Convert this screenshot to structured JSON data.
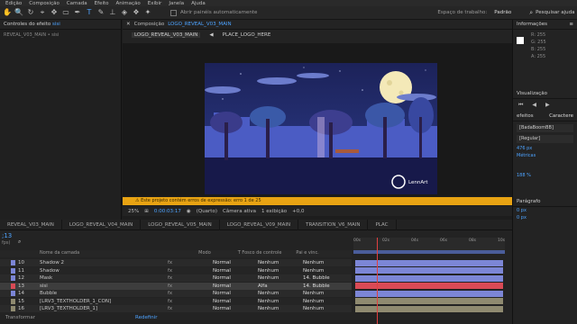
{
  "menu": [
    "Edição",
    "Composição",
    "Camada",
    "Efeito",
    "Animação",
    "Exibir",
    "Janela",
    "Ajuda"
  ],
  "toolbar": {
    "auto_open_label": "Abrir painéis automaticamente",
    "workspace_label": "Espaço de trabalho:",
    "workspace_value": "Padrão",
    "search_help": "Pesquisar ajuda"
  },
  "left_panel": {
    "tab": "Controles do efeito",
    "tab_suffix": "sisi",
    "subtitle": "REVEAL_V03_MAIN • sisi"
  },
  "comp": {
    "tab": "Composição",
    "tab_name": "LOGO_REVEAL_V03_MAIN",
    "crumb1": "LOGO_REVEAL_V03_MAIN",
    "crumb2": "PLACE_LOGO_HERE",
    "warning": "Este projeto contém erros de expressão: erro 1 de 25",
    "zoom": "25%",
    "timecode": "0:00:03:17",
    "quality": "(Quarto)",
    "camera": "Câmera ativa",
    "view": "1 exibição",
    "exposure": "+0,0",
    "logo_text": "LennArt"
  },
  "timeline_tabs": [
    "REVEAL_V03_MAIN",
    "LOGO_REVEAL_V04_MAIN",
    "LOGO_REVEAL_V05_MAIN",
    "LOGO_REVEAL_V09_MAIN",
    "TRANSITION_V6_MAIN",
    "PLAC"
  ],
  "timeline": {
    "time": ";13",
    "fps": "fps)",
    "col_name": "Nome da camada",
    "col_mode": "Modo",
    "col_track": "T   Fosco de controle",
    "col_parent": "Pai e vinc.",
    "ruler": [
      "00s",
      "02s",
      "04s",
      "06s",
      "08s",
      "10s"
    ],
    "footer_left": "Transformar",
    "footer_right": "Redefinir",
    "layers": [
      {
        "num": "10",
        "name": "Shadow 2",
        "mode": "Normal",
        "track": "Nenhum",
        "parent": "Nenhum",
        "color": "#7c86d6"
      },
      {
        "num": "11",
        "name": "Shadow",
        "mode": "Normal",
        "track": "Nenhum",
        "parent": "Nenhum",
        "color": "#7c86d6"
      },
      {
        "num": "12",
        "name": "Mask",
        "mode": "Normal",
        "track": "Nenhum",
        "parent": "14. Bubble",
        "color": "#7c86d6"
      },
      {
        "num": "13",
        "name": "sisi",
        "mode": "Normal",
        "track": "Alfa",
        "parent": "14. Bubble",
        "color": "#d94a55"
      },
      {
        "num": "14",
        "name": "Bubble",
        "mode": "Normal",
        "track": "Nenhum",
        "parent": "Nenhum",
        "color": "#7c86d6"
      },
      {
        "num": "15",
        "name": "[LRV3_TEXTHOLDER_1_CON]",
        "mode": "Normal",
        "track": "Nenhum",
        "parent": "Nenhum",
        "color": "#8f8a70"
      },
      {
        "num": "16",
        "name": "[LRV3_TEXTHOLDER_1]",
        "mode": "Normal",
        "track": "Nenhum",
        "parent": "Nenhum",
        "color": "#8f8a70"
      }
    ]
  },
  "right_panel": {
    "info_title": "Informações",
    "r": "R: 255",
    "g": "G: 255",
    "b": "B: 255",
    "a": "A: 255",
    "visual_title": "Visualização",
    "effects_tab": "efeitos",
    "char_tab": "Caractere",
    "font": "[BadaBoomBB]",
    "style": "[Regular]",
    "size": "476 px",
    "leading": "Métricas",
    "tracking": "188 %",
    "para_title": "Parágrafo",
    "p1": "0 px",
    "p2": "0 px"
  }
}
